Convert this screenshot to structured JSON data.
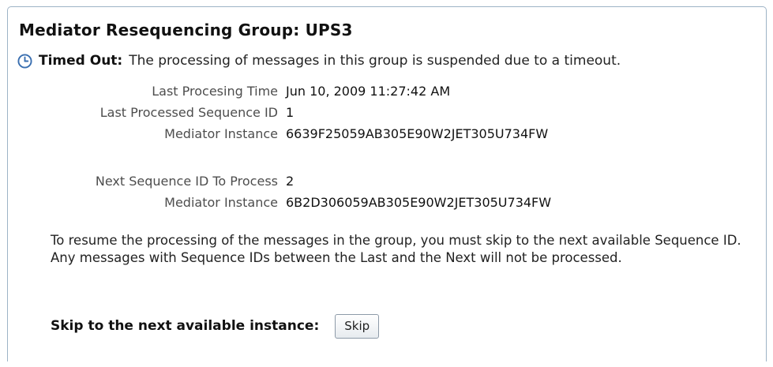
{
  "panel": {
    "title": "Mediator Resequencing Group: UPS3"
  },
  "status": {
    "icon": "clock-icon",
    "label": "Timed Out:",
    "text": "The processing of messages in this group is suspended due to a timeout."
  },
  "last": {
    "processing_time_label": "Last Procesing Time",
    "processing_time_value": "Jun 10, 2009 11:27:42 AM",
    "sequence_id_label": "Last Processed Sequence ID",
    "sequence_id_value": "1",
    "instance_label": "Mediator Instance",
    "instance_value": "6639F25059AB305E90W2JET305U734FW"
  },
  "next": {
    "sequence_id_label": "Next Sequence ID To Process",
    "sequence_id_value": "2",
    "instance_label": "Mediator Instance",
    "instance_value": "6B2D306059AB305E90W2JET305U734FW"
  },
  "description": "To resume the processing of the messages in the group, you must skip to the next available Sequence ID. Any messages with Sequence IDs between the Last and the Next will not be processed.",
  "skip": {
    "label": "Skip to the next available instance:",
    "button_label": "Skip"
  },
  "colors": {
    "panel_border": "#9db3c6",
    "clock_icon": "#3a6fb0",
    "field_label": "#4d4d4d"
  }
}
